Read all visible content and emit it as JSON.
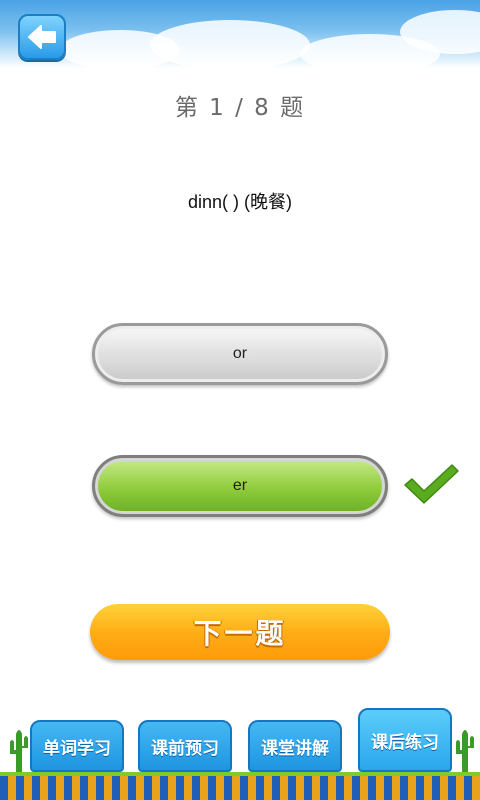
{
  "header": {
    "back_icon": "arrow-left-icon"
  },
  "quiz": {
    "progress_title": "第 1 / 8 题",
    "question": "dinn( ) (晚餐)",
    "options": [
      {
        "label": "or",
        "state": "normal"
      },
      {
        "label": "er",
        "state": "correct"
      }
    ],
    "correct_icon": "checkmark-icon",
    "next_label": "下一题"
  },
  "tabs": [
    {
      "label": "单词学习"
    },
    {
      "label": "课前预习"
    },
    {
      "label": "课堂讲解"
    },
    {
      "label": "课后练习"
    }
  ],
  "colors": {
    "correct": "#8fcc3c",
    "check": "#5aab1e",
    "next_button": "#ffae17",
    "tab": "#1e95e2"
  }
}
